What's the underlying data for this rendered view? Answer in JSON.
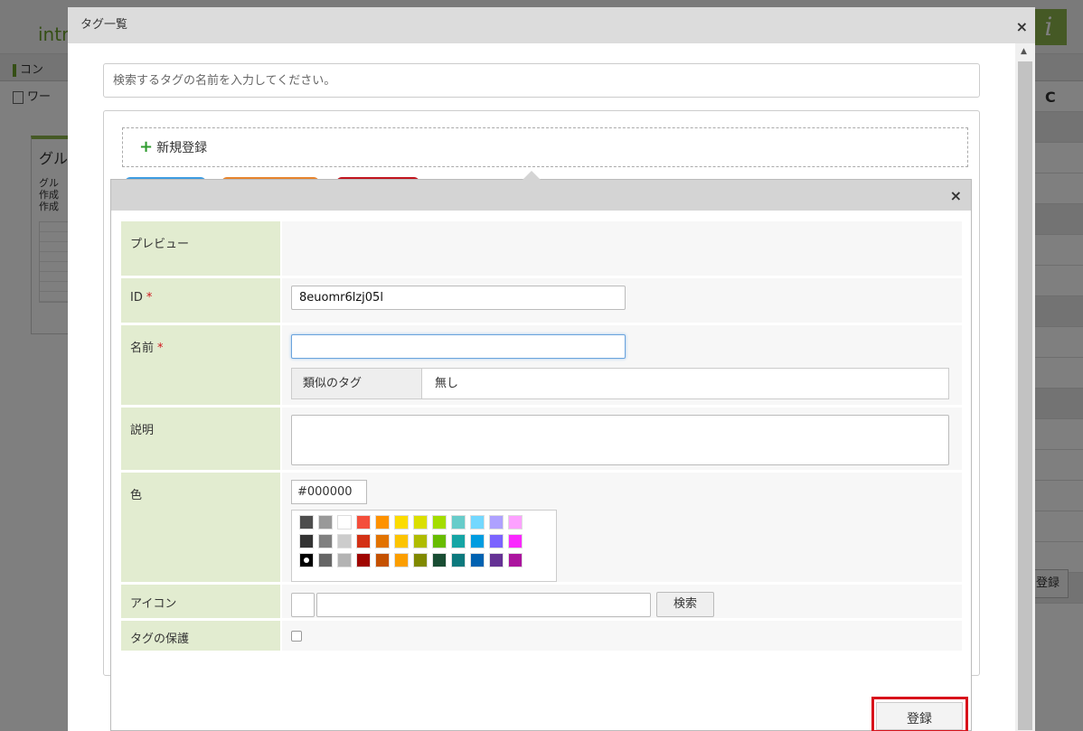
{
  "background": {
    "logo": "intr",
    "logo_badge": "i",
    "nav_item_1": "コン",
    "nav_item_2": "ワー",
    "card_title": "グル",
    "card_lines": [
      "グル",
      "作成",
      "作成"
    ],
    "right_button": "登録"
  },
  "outer_dialog": {
    "title": "タグ一覧",
    "close": "×",
    "search_placeholder": "検索するタグの名前を入力してください。",
    "new_register": "新規登録"
  },
  "tag_chip_colors": [
    "#3d9be0",
    "#e6832c",
    "#c0141d"
  ],
  "form": {
    "close": "×",
    "labels": {
      "preview": "プレビュー",
      "id": "ID",
      "name": "名前",
      "description": "説明",
      "color": "色",
      "icon": "アイコン",
      "protect": "タグの保護"
    },
    "required_mark": "*",
    "id_value": "8euomr6lzj05l",
    "name_value": "",
    "similar_label": "類似のタグ",
    "similar_value": "無し",
    "color_value": "#000000",
    "palette": [
      [
        "#4d4d4d",
        "#999999",
        "#ffffff",
        "#f44e3b",
        "#fe9200",
        "#fcdc00",
        "#dbdf00",
        "#a4dd00",
        "#68ccca",
        "#73d8ff",
        "#aea1ff",
        "#fda1ff"
      ],
      [
        "#333333",
        "#808080",
        "#cccccc",
        "#d33115",
        "#e27300",
        "#fcc400",
        "#b0bc00",
        "#68bc00",
        "#16a5a5",
        "#009ce0",
        "#7b64ff",
        "#fa28ff"
      ],
      [
        "#000000",
        "#666666",
        "#b3b3b3",
        "#9f0500",
        "#c45100",
        "#fb9e00",
        "#808900",
        "#194d33",
        "#0c797d",
        "#0062b1",
        "#653294",
        "#ab149e"
      ]
    ],
    "icon_search_button": "検索",
    "submit": "登録"
  }
}
